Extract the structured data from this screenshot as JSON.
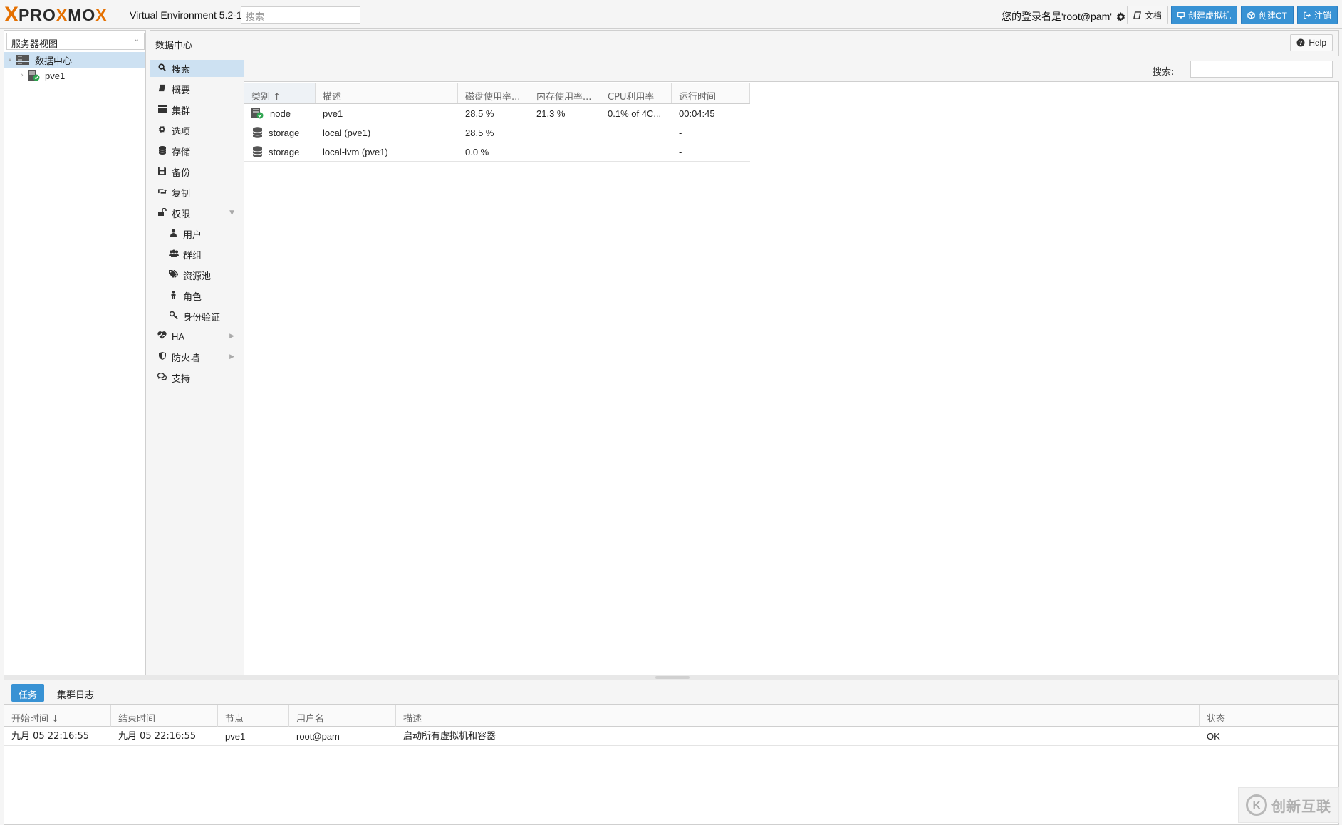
{
  "app": {
    "logo_x": "X",
    "logo_text_1": "PRO",
    "logo_text_x": "X",
    "logo_text_2": "MO",
    "logo_text_x2": "X",
    "version": "Virtual Environment 5.2-1",
    "search_placeholder": "搜索",
    "user_label": "您的登录名是'root@pam'",
    "buttons": {
      "docs": "文档",
      "create_vm": "创建虚拟机",
      "create_ct": "创建CT",
      "logout": "注销"
    },
    "colors": {
      "accent": "#3892d4",
      "brand_orange": "#e57000",
      "selected": "#cde1f2"
    }
  },
  "tree": {
    "view_selector": "服务器视图",
    "nodes": [
      {
        "label": "数据中心",
        "icon": "datacenter-icon"
      },
      {
        "label": "pve1",
        "icon": "node-online-icon"
      }
    ]
  },
  "header": {
    "title": "数据中心",
    "help_label": "Help"
  },
  "nav": {
    "items": [
      {
        "label": "搜索",
        "icon": "search-icon"
      },
      {
        "label": "概要",
        "icon": "book-icon"
      },
      {
        "label": "集群",
        "icon": "server-icon"
      },
      {
        "label": "选项",
        "icon": "gear-icon"
      },
      {
        "label": "存储",
        "icon": "database-icon"
      },
      {
        "label": "备份",
        "icon": "floppy-icon"
      },
      {
        "label": "复制",
        "icon": "retweet-icon"
      },
      {
        "label": "权限",
        "icon": "unlock-icon"
      },
      {
        "label": "用户",
        "icon": "user-icon"
      },
      {
        "label": "群组",
        "icon": "users-icon"
      },
      {
        "label": "资源池",
        "icon": "tags-icon"
      },
      {
        "label": "角色",
        "icon": "male-icon"
      },
      {
        "label": "身份验证",
        "icon": "key-icon"
      },
      {
        "label": "HA",
        "icon": "heartbeat-icon"
      },
      {
        "label": "防火墙",
        "icon": "shield-icon"
      },
      {
        "label": "支持",
        "icon": "comments-icon"
      }
    ]
  },
  "search_panel": {
    "search_label": "搜索:",
    "columns": [
      "类别 ↑",
      "描述",
      "磁盘使用率...",
      "内存使用率...",
      "CPU利用率",
      "运行时间"
    ],
    "rows": [
      {
        "type": "node",
        "desc": "pve1",
        "disk": "28.5 %",
        "mem": "21.3 %",
        "cpu": "0.1% of 4C...",
        "uptime": "00:04:45"
      },
      {
        "type": "storage",
        "desc": "local (pve1)",
        "disk": "28.5 %",
        "mem": "",
        "cpu": "",
        "uptime": "-"
      },
      {
        "type": "storage",
        "desc": "local-lvm (pve1)",
        "disk": "0.0 %",
        "mem": "",
        "cpu": "",
        "uptime": "-"
      }
    ]
  },
  "bottom": {
    "tabs": [
      "任务",
      "集群日志"
    ],
    "columns": [
      "开始时间 ↓",
      "结束时间",
      "节点",
      "用户名",
      "描述",
      "状态"
    ],
    "rows": [
      {
        "start": "九月 05 22:16:55",
        "end": "九月 05 22:16:55",
        "node": "pve1",
        "user": "root@pam",
        "desc": "启动所有虚拟机和容器",
        "status": "OK"
      }
    ]
  },
  "watermark": {
    "logo": "K",
    "text": "创新互联"
  }
}
